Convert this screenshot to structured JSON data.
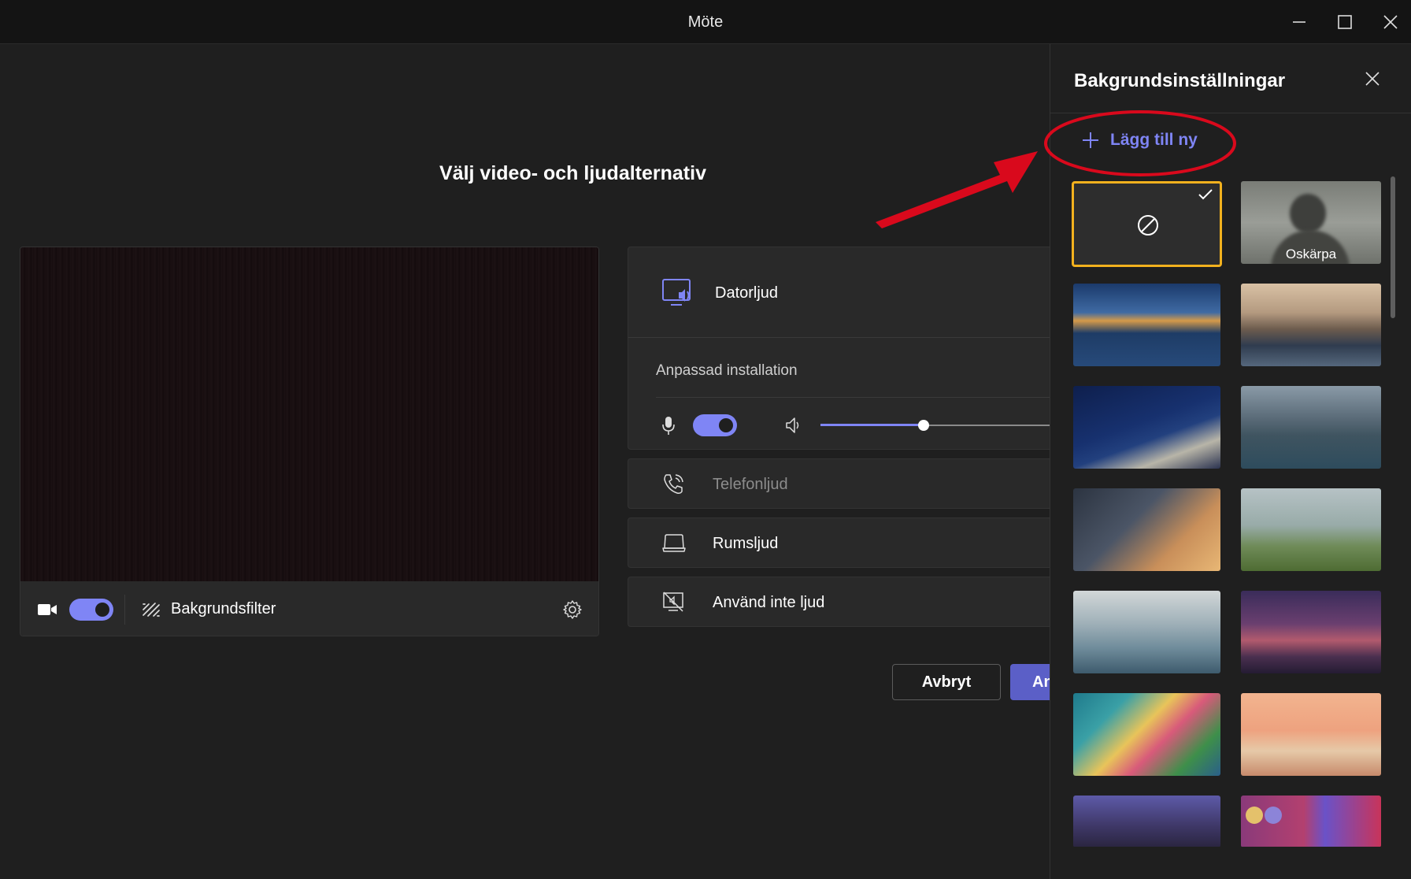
{
  "window": {
    "title": "Möte",
    "controls": [
      "minimize-icon",
      "maximize-icon",
      "close-icon"
    ]
  },
  "main": {
    "heading": "Välj video- och ljudalternativ",
    "video_bar": {
      "camera_on": true,
      "background_filter_label": "Bakgrundsfilter"
    },
    "audio": {
      "computer_audio_label": "Datorljud",
      "custom_setup_label": "Anpassad installation",
      "mic_on": true,
      "speaker_volume": 0.45,
      "phone_audio_label": "Telefonljud",
      "room_audio_label": "Rumsljud",
      "no_audio_label": "Använd inte ljud"
    },
    "buttons": {
      "cancel": "Avbryt",
      "join": "An"
    }
  },
  "side_panel": {
    "title": "Bakgrundsinställningar",
    "add_new_label": "Lägg till ny",
    "selected_index": 0,
    "backgrounds": [
      {
        "type": "none",
        "label": ""
      },
      {
        "type": "blur",
        "label": "Oskärpa"
      },
      {
        "type": "image",
        "label": "",
        "scene": "harbor-evening"
      },
      {
        "type": "image",
        "label": "",
        "scene": "city-waterfront"
      },
      {
        "type": "image",
        "label": "",
        "scene": "night-bridge"
      },
      {
        "type": "image",
        "label": "",
        "scene": "aerial-city"
      },
      {
        "type": "image",
        "label": "",
        "scene": "geometric-building-sun"
      },
      {
        "type": "image",
        "label": "",
        "scene": "grass-city"
      },
      {
        "type": "image",
        "label": "",
        "scene": "plants-sky"
      },
      {
        "type": "image",
        "label": "",
        "scene": "sunset-city"
      },
      {
        "type": "image",
        "label": "",
        "scene": "colorful-waves"
      },
      {
        "type": "image",
        "label": "",
        "scene": "fantasy-cake"
      },
      {
        "type": "image",
        "label": "",
        "scene": "room-interior"
      },
      {
        "type": "image",
        "label": "",
        "scene": "abstract-purple"
      }
    ]
  },
  "colors": {
    "accent": "#7f85f5",
    "join_button": "#5b5fc7",
    "selected_border": "#f2b11e",
    "annotation_red": "#d9091c"
  }
}
